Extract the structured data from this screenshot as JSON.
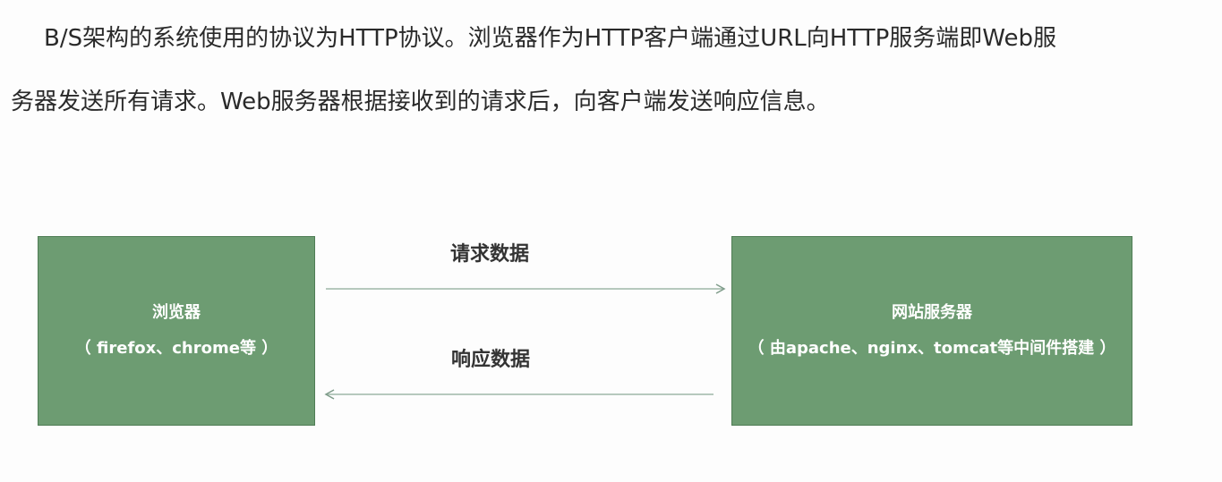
{
  "paragraph": {
    "line1": "B/S架构的系统使用的协议为HTTP协议。浏览器作为HTTP客户端通过URL向HTTP服务端即Web服",
    "line2": "务器发送所有请求。Web服务器根据接收到的请求后，向客户端发送响应信息。"
  },
  "diagram": {
    "client_box": {
      "title": "浏览器",
      "subtitle": "（ firefox、chrome等 ）"
    },
    "server_box": {
      "title": "网站服务器",
      "subtitle": "（ 由apache、nginx、tomcat等中间件搭建 ）"
    },
    "request_label": "请求数据",
    "response_label": "响应数据"
  },
  "colors": {
    "box_fill": "#6d9c72",
    "arrow": "#9fb8a8"
  }
}
